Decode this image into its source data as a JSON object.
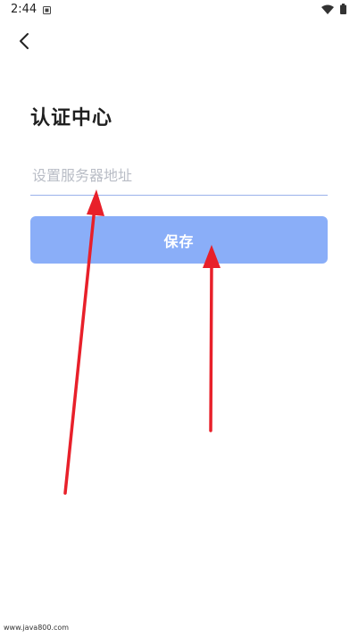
{
  "status_bar": {
    "time": "2:44",
    "icons": [
      "sim-card-icon",
      "wifi-icon",
      "battery-icon"
    ]
  },
  "nav": {
    "back_icon": "chevron-left-icon"
  },
  "title": "认证中心",
  "server_field": {
    "value": "",
    "placeholder": "设置服务器地址"
  },
  "save_button": {
    "label": "保存"
  },
  "annotations": {
    "arrow_color": "#e8202a",
    "arrows": [
      "arrow-to-server-field",
      "arrow-to-save-button"
    ]
  },
  "watermark": "www.java800.com",
  "colors": {
    "accent": "#8aaef8",
    "underline": "#9bb2ea",
    "placeholder": "#b9bdc6"
  }
}
